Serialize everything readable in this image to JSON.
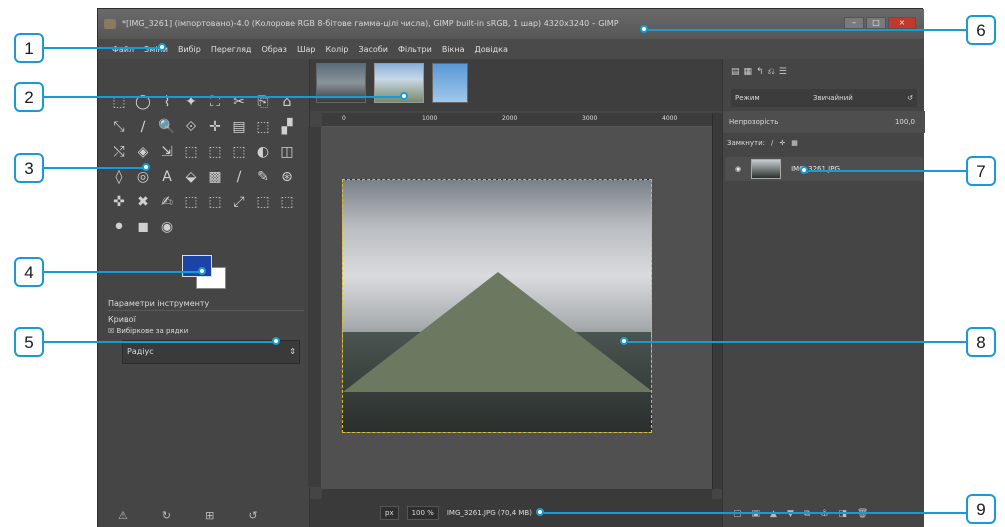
{
  "window": {
    "title": "*[IMG_3261] (імпортовано)-4.0 (Колорове RGB 8-бітове гамма-цілі числа), GIMP built-in sRGB, 1 шар) 4320x3240 – GIMP",
    "buttons": [
      "–",
      "□",
      "×"
    ]
  },
  "menu": [
    "Файл",
    "Зміни",
    "Вибір",
    "Перегляд",
    "Образ",
    "Шар",
    "Колір",
    "Засоби",
    "Фільтри",
    "Вікна",
    "Довідка"
  ],
  "toolbox": {
    "tool_icons": [
      "⬚",
      "◯",
      "⌇",
      "✦",
      "⛶",
      "✂",
      "⎘",
      "⌂",
      "⤡",
      "∕",
      "🔍",
      "⟐",
      "✛",
      "▤",
      "⬚",
      "▞",
      "⤭",
      "◈",
      "⇲",
      "⬚",
      "⬚",
      "⬚",
      "◐",
      "◫",
      "◊",
      "◎",
      "A",
      "⬙",
      "▩",
      "∕",
      "✎",
      "⊛",
      "✜",
      "✖",
      "✍",
      "⬚",
      "⬚",
      "⤢",
      "⬚",
      "⬚",
      "⚫",
      "◼",
      "◉"
    ],
    "options_title": "Параметри інструменту",
    "section": "Кривої",
    "checkbox": "Вибіркове за рядки",
    "field": "Радіус",
    "bottom_icons": [
      "⚠",
      "↻",
      "⊞",
      "↺"
    ]
  },
  "tabs": [
    "image-1",
    "image-2",
    "image-3"
  ],
  "ruler_labels": [
    "0",
    "1000",
    "2000",
    "3000",
    "4000"
  ],
  "status": {
    "unit": "px",
    "zoom": "100 %",
    "info": "IMG_3261.JPG (70,4 MB)"
  },
  "dock": {
    "mode_label": "Режим",
    "mode_value": "Звичайний",
    "opacity_label": "Непрозорість",
    "opacity_value": "100,0",
    "lock_label": "Замкнути:",
    "layer_name": "IMG_3261.JPG"
  },
  "callouts": [
    "1",
    "2",
    "3",
    "4",
    "5",
    "6",
    "7",
    "8",
    "9"
  ],
  "accent": "#1a9ad4"
}
